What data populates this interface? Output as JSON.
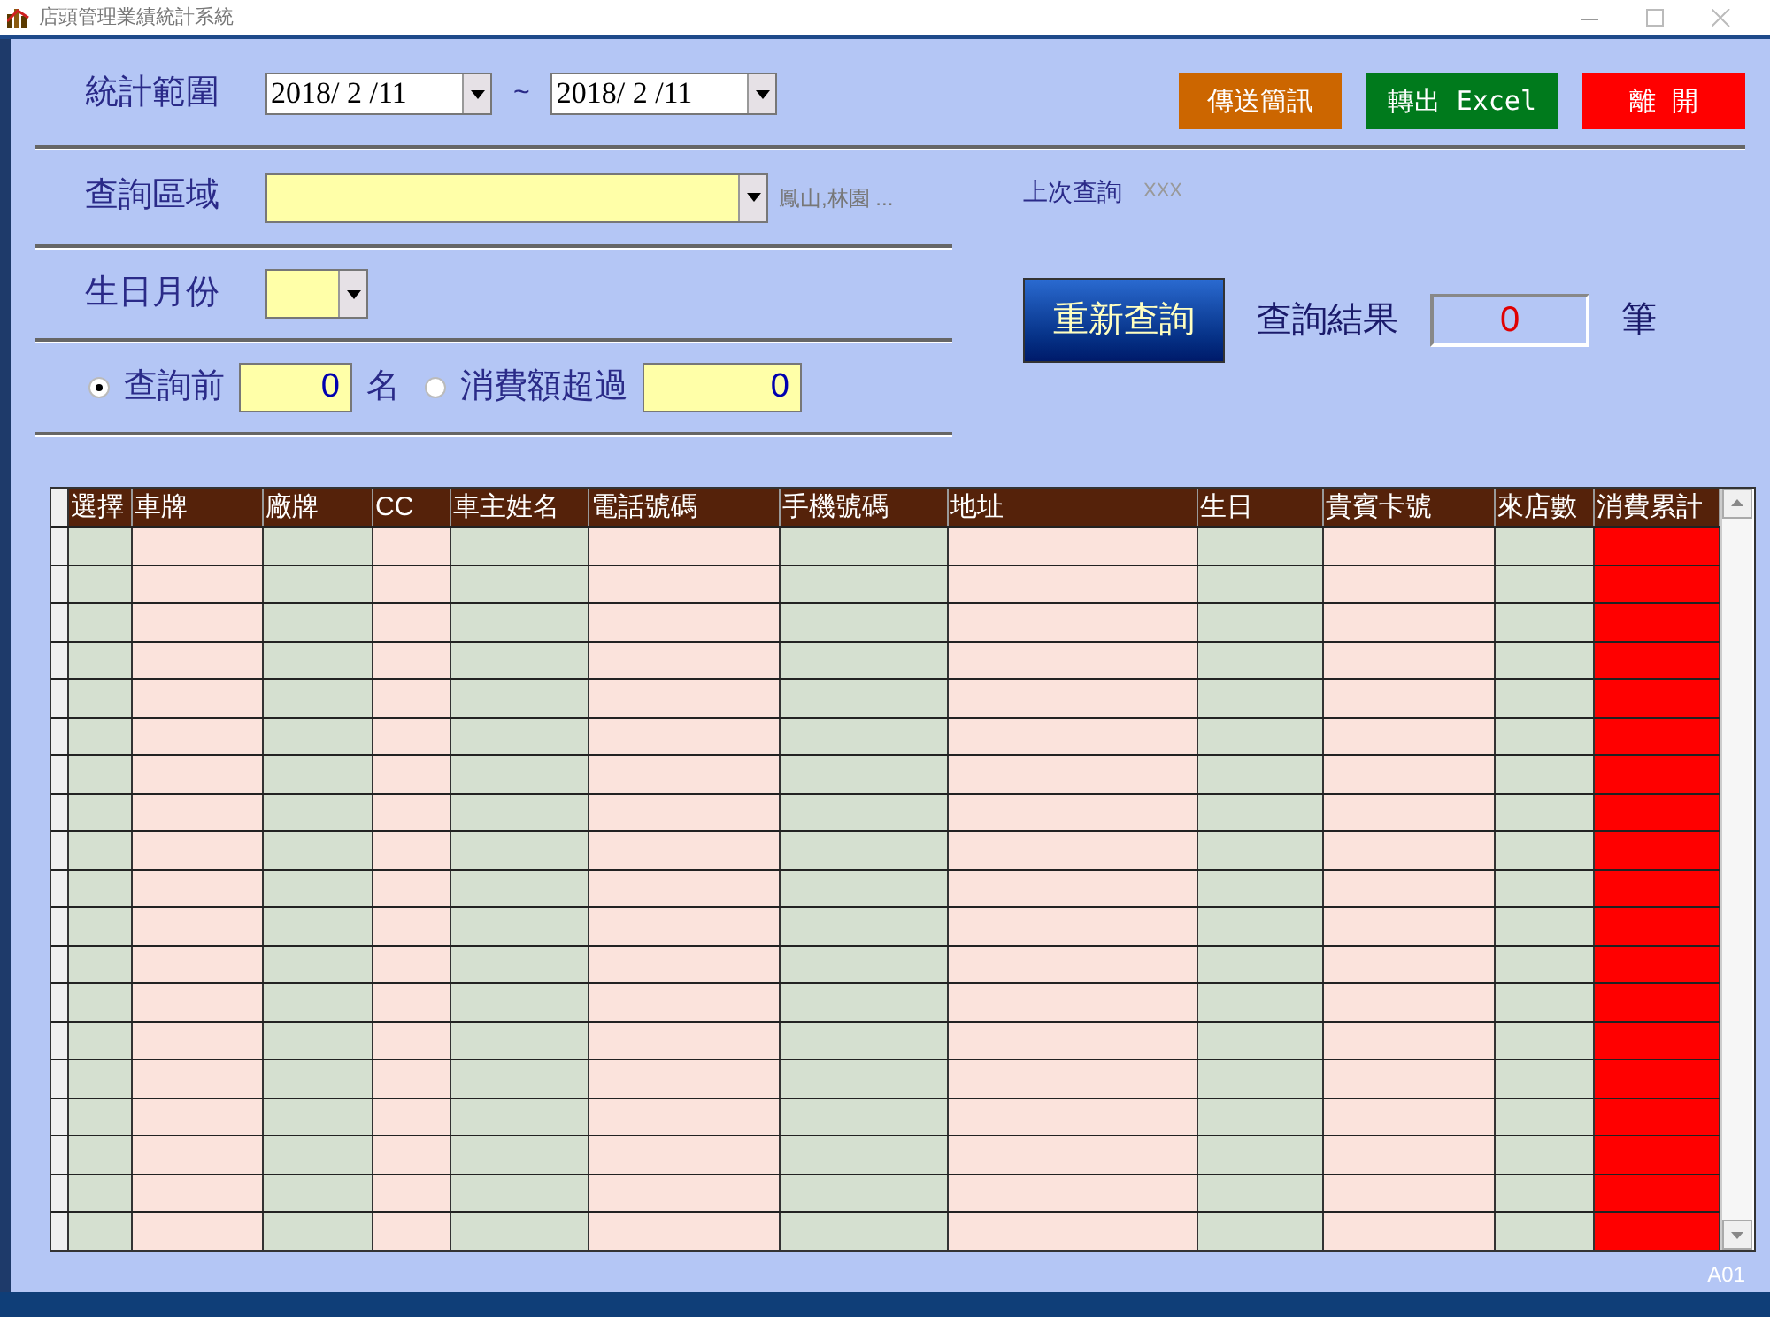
{
  "window": {
    "title": "店頭管理業績統計系統"
  },
  "date_range": {
    "label": "統計範圍",
    "from": "2018/ 2 /11",
    "separator": "~",
    "to": "2018/ 2 /11"
  },
  "actions": [
    {
      "label": "傳送簡訊",
      "color": "#cc6600"
    },
    {
      "label": "轉出 Excel",
      "color": "#007a1c"
    },
    {
      "label": "離 開",
      "color": "#ff0000"
    }
  ],
  "area": {
    "label": "查詢區域",
    "hint": "鳳山,林園 ..."
  },
  "last_query": {
    "label": "上次查詢",
    "value": "XXX"
  },
  "birth_month": {
    "label": "生日月份"
  },
  "options": [
    {
      "label": "查詢前",
      "value": "0",
      "suffix": "名",
      "selected": true
    },
    {
      "label": "消費額超過",
      "value": "0",
      "selected": false
    }
  ],
  "requery_button": "重新查詢",
  "result": {
    "label": "查詢結果",
    "value": "0",
    "unit": "筆"
  },
  "table": {
    "columns": [
      {
        "label": "選擇",
        "color": "#d5e0d0"
      },
      {
        "label": "車牌",
        "color": "#fbe3dc"
      },
      {
        "label": "廠牌",
        "color": "#d5e0d0"
      },
      {
        "label": "CC",
        "color": "#fbe3dc"
      },
      {
        "label": "車主姓名",
        "color": "#d5e0d0"
      },
      {
        "label": "電話號碼",
        "color": "#fbe3dc"
      },
      {
        "label": "手機號碼",
        "color": "#d5e0d0"
      },
      {
        "label": "地址",
        "color": "#fbe3dc"
      },
      {
        "label": "生日",
        "color": "#d5e0d0"
      },
      {
        "label": "貴賓卡號",
        "color": "#fbe3dc"
      },
      {
        "label": "來店數",
        "color": "#d5e0d0"
      },
      {
        "label": "消費累計",
        "color": "#ff0000"
      }
    ]
  },
  "status_bar": {
    "code": "A01"
  }
}
